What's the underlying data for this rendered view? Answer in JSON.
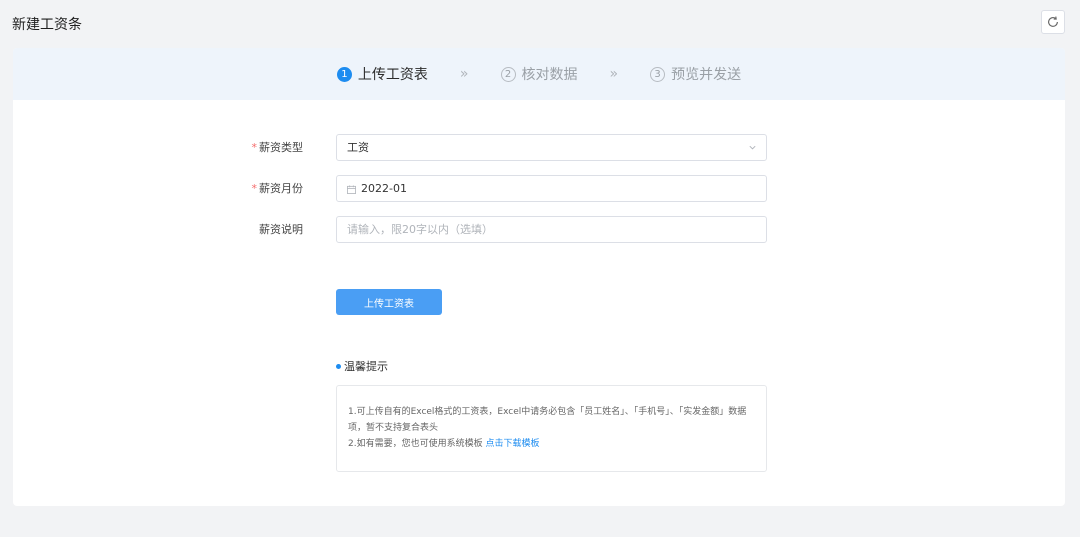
{
  "page": {
    "title": "新建工资条"
  },
  "steps": [
    {
      "num": "1",
      "label": "上传工资表"
    },
    {
      "num": "2",
      "label": "核对数据"
    },
    {
      "num": "3",
      "label": "预览并发送"
    }
  ],
  "step_separator": "»",
  "form": {
    "type_label": "薪资类型",
    "type_value": "工资",
    "month_label": "薪资月份",
    "month_value": "2022-01",
    "desc_label": "薪资说明",
    "desc_placeholder": "请输入，限20字以内（选填）",
    "required_mark": "*"
  },
  "upload_button": "上传工资表",
  "tips": {
    "title": "温馨提示",
    "line1": "1.可上传自有的Excel格式的工资表，Excel中请务必包含「员工姓名」、「手机号」、「实发金额」数据项，暂不支持复合表头",
    "line2_prefix": "2.如有需要，您也可使用系统模板 ",
    "line2_link": "点击下载模板"
  },
  "colors": {
    "accent": "#1d8cf0",
    "button": "#4a9ef4",
    "required": "#f56c6c",
    "steps_bg": "#eef4fb"
  }
}
